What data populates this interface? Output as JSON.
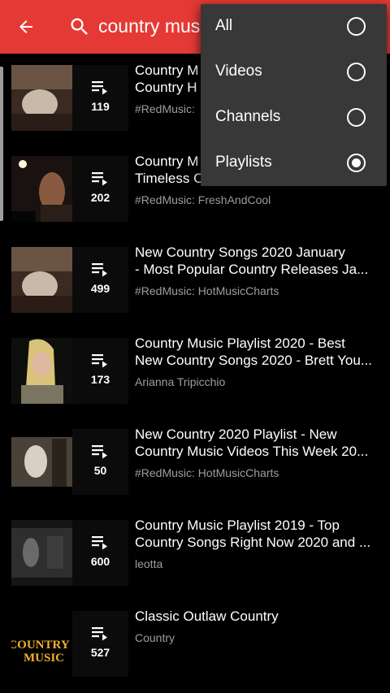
{
  "search": {
    "query": "country mus"
  },
  "filter_menu": {
    "options": [
      {
        "label": "All",
        "selected": false
      },
      {
        "label": "Videos",
        "selected": false
      },
      {
        "label": "Channels",
        "selected": false
      },
      {
        "label": "Playlists",
        "selected": true
      }
    ]
  },
  "results": [
    {
      "title_line1": "Country M",
      "title_line2": "Country H",
      "subtitle": "#RedMusic:",
      "count": "119"
    },
    {
      "title_line1": "Country M",
      "title_line2": "Timeless Country Songs & Country ...",
      "subtitle": "#RedMusic: FreshAndCool",
      "count": "202"
    },
    {
      "title_line1": "New Country Songs 2020 January",
      "title_line2": "- Most Popular Country Releases Ja...",
      "subtitle": "#RedMusic: HotMusicCharts",
      "count": "499"
    },
    {
      "title_line1": "Country Music Playlist 2020 - Best",
      "title_line2": "New Country Songs 2020 - Brett You...",
      "subtitle": "Arianna Tripicchio",
      "count": "173"
    },
    {
      "title_line1": "New Country 2020 Playlist - New",
      "title_line2": "Country Music Videos This Week 20...",
      "subtitle": "#RedMusic: HotMusicCharts",
      "count": "50"
    },
    {
      "title_line1": "Country Music Playlist 2019 - Top",
      "title_line2": "Country Songs Right Now 2020 and ...",
      "subtitle": "leotta",
      "count": "600"
    },
    {
      "title_line1": "Classic Outlaw Country",
      "title_line2": "",
      "subtitle": "Country",
      "count": "527",
      "thumb_text": "COUNTRY MUSIC"
    }
  ],
  "colors": {
    "appbar": "#e53935",
    "background": "#000000",
    "menu": "#383838",
    "subtitle": "#9e9e9e"
  }
}
